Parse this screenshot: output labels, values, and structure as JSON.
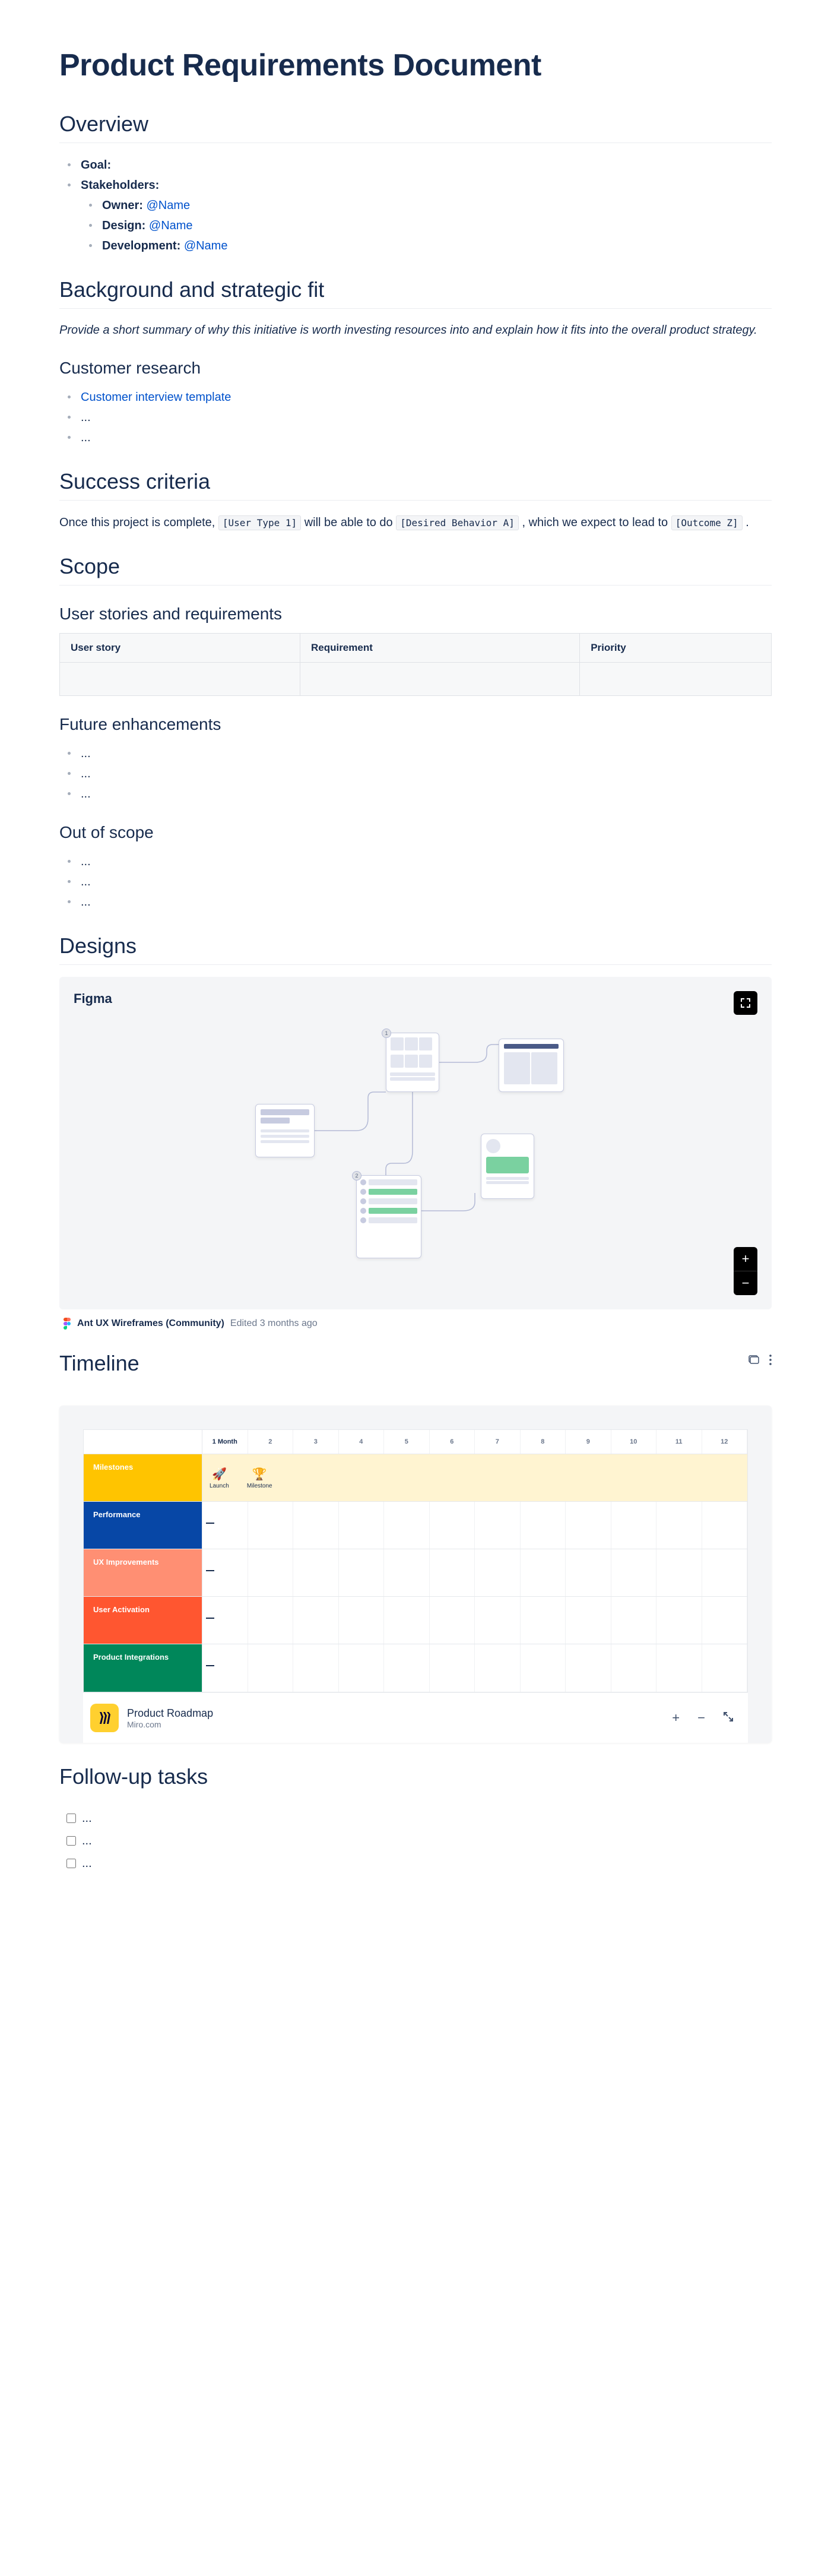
{
  "doc_title": "Product Requirements Document",
  "overview": {
    "heading": "Overview",
    "goal_label": "Goal:",
    "stakeholders_label": "Stakeholders:",
    "owner_label": "Owner: ",
    "owner_mention": "@Name",
    "design_label": "Design: ",
    "design_mention": "@Name",
    "dev_label": "Development: ",
    "dev_mention": "@Name"
  },
  "background": {
    "heading": "Background and strategic fit",
    "hint": "Provide a short summary of why this initiative is worth investing resources into and explain how it fits into the overall product strategy.",
    "research_heading": "Customer research",
    "link1": "Customer interview template",
    "item2": "...",
    "item3": "..."
  },
  "success": {
    "heading": "Success criteria",
    "pre": "Once this project is complete, ",
    "code1": "[User Type 1]",
    "mid1": " will be able to do ",
    "code2": "[Desired Behavior A]",
    "mid2": " , which we expect to lead to ",
    "code3": "[Outcome Z]",
    "post": " ."
  },
  "scope": {
    "heading": "Scope",
    "stories_heading": "User stories and requirements",
    "col1": "User story",
    "col2": "Requirement",
    "col3": "Priority",
    "future_heading": "Future enhancements",
    "f1": "...",
    "f2": "...",
    "f3": "...",
    "out_heading": "Out of scope",
    "o1": "...",
    "o2": "...",
    "o3": "..."
  },
  "designs": {
    "heading": "Designs",
    "figma_label": "Figma",
    "caption_title": "Ant UX Wireframes (Community)",
    "caption_meta": "Edited 3 months ago"
  },
  "timeline": {
    "heading": "Timeline",
    "months": [
      "1 Month",
      "2",
      "3",
      "4",
      "5",
      "6",
      "7",
      "8",
      "9",
      "10",
      "11",
      "12"
    ],
    "rows": [
      {
        "label": "Milestones",
        "color": "#ffc400",
        "milestone_labels": [
          "Launch",
          "Milestone"
        ],
        "strip_color": "#fff4d1"
      },
      {
        "label": "Performance",
        "color": "#0747a6"
      },
      {
        "label": "UX Improvements",
        "color": "#ff8f73"
      },
      {
        "label": "User Activation",
        "color": "#ff5630"
      },
      {
        "label": "Product Integrations",
        "color": "#00875a"
      }
    ],
    "footer_title": "Product Roadmap",
    "footer_sub": "Miro.com"
  },
  "tasks": {
    "heading": "Follow-up tasks",
    "t1": "...",
    "t2": "...",
    "t3": "..."
  }
}
